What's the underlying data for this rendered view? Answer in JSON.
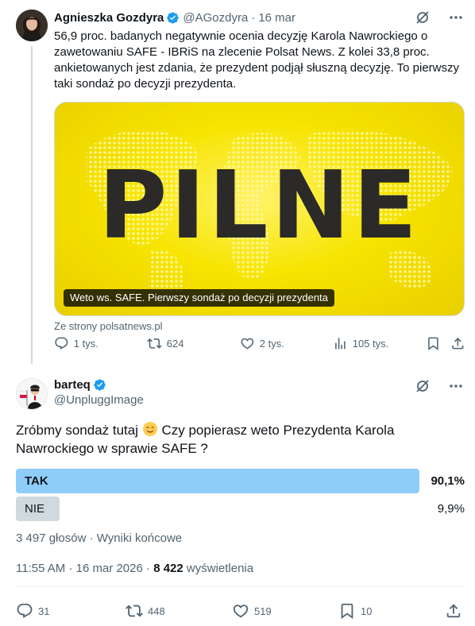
{
  "quoted_tweet": {
    "author_name": "Agnieszka Gozdyra",
    "author_handle": "@AGozdyra",
    "date": "16 mar",
    "text": "56,9 proc. badanych negatywnie ocenia decyzję Karola Nawrockiego o zawetowaniu SAFE - IBRiS na zlecenie Polsat News. Z kolei 33,8 proc. ankietowanych jest zdania, że prezydent podjął słuszną decyzję. To pierwszy taki sondaż po decyzji prezydenta.",
    "card": {
      "headline": "PILNE",
      "caption": "Weto ws. SAFE. Pierwszy sondaż po decyzji prezydenta",
      "source": "Ze strony polsatnews.pl"
    },
    "stats": {
      "replies": "1 tys.",
      "reposts": "624",
      "likes": "2 tys.",
      "views": "105 tys."
    }
  },
  "main_tweet": {
    "author_name": "barteq",
    "author_handle": "@UnpluggImage",
    "text_before_emoji": "Zróbmy sondaż tutaj ",
    "text_after_emoji": " Czy popierasz weto Prezydenta Karola Nawrockiego w sprawie SAFE ?",
    "poll": {
      "options": [
        {
          "label": "TAK",
          "percent_text": "90,1%",
          "percent": 90.1,
          "winner": true
        },
        {
          "label": "NIE",
          "percent_text": "9,9%",
          "percent": 9.9,
          "winner": false
        }
      ],
      "votes": "3 497 głosów",
      "status": "Wyniki końcowe"
    },
    "time": "11:55 AM",
    "date": "16 mar 2026",
    "views_count": "8 422",
    "views_label": "wyświetlenia",
    "stats": {
      "replies": "31",
      "reposts": "448",
      "likes": "519",
      "bookmarks": "10"
    }
  },
  "colors": {
    "verified": "#1d9bf0",
    "poll_winner": "#8ecdf8",
    "poll_other": "#cfd9de",
    "muted": "#536471",
    "card_yellow": "#f7e400"
  },
  "icons": [
    "verified-badge-icon",
    "grok-slash-icon",
    "more-icon",
    "reply-icon",
    "repost-icon",
    "like-icon",
    "views-icon",
    "bookmark-icon",
    "share-icon",
    "relieved-face-emoji"
  ]
}
